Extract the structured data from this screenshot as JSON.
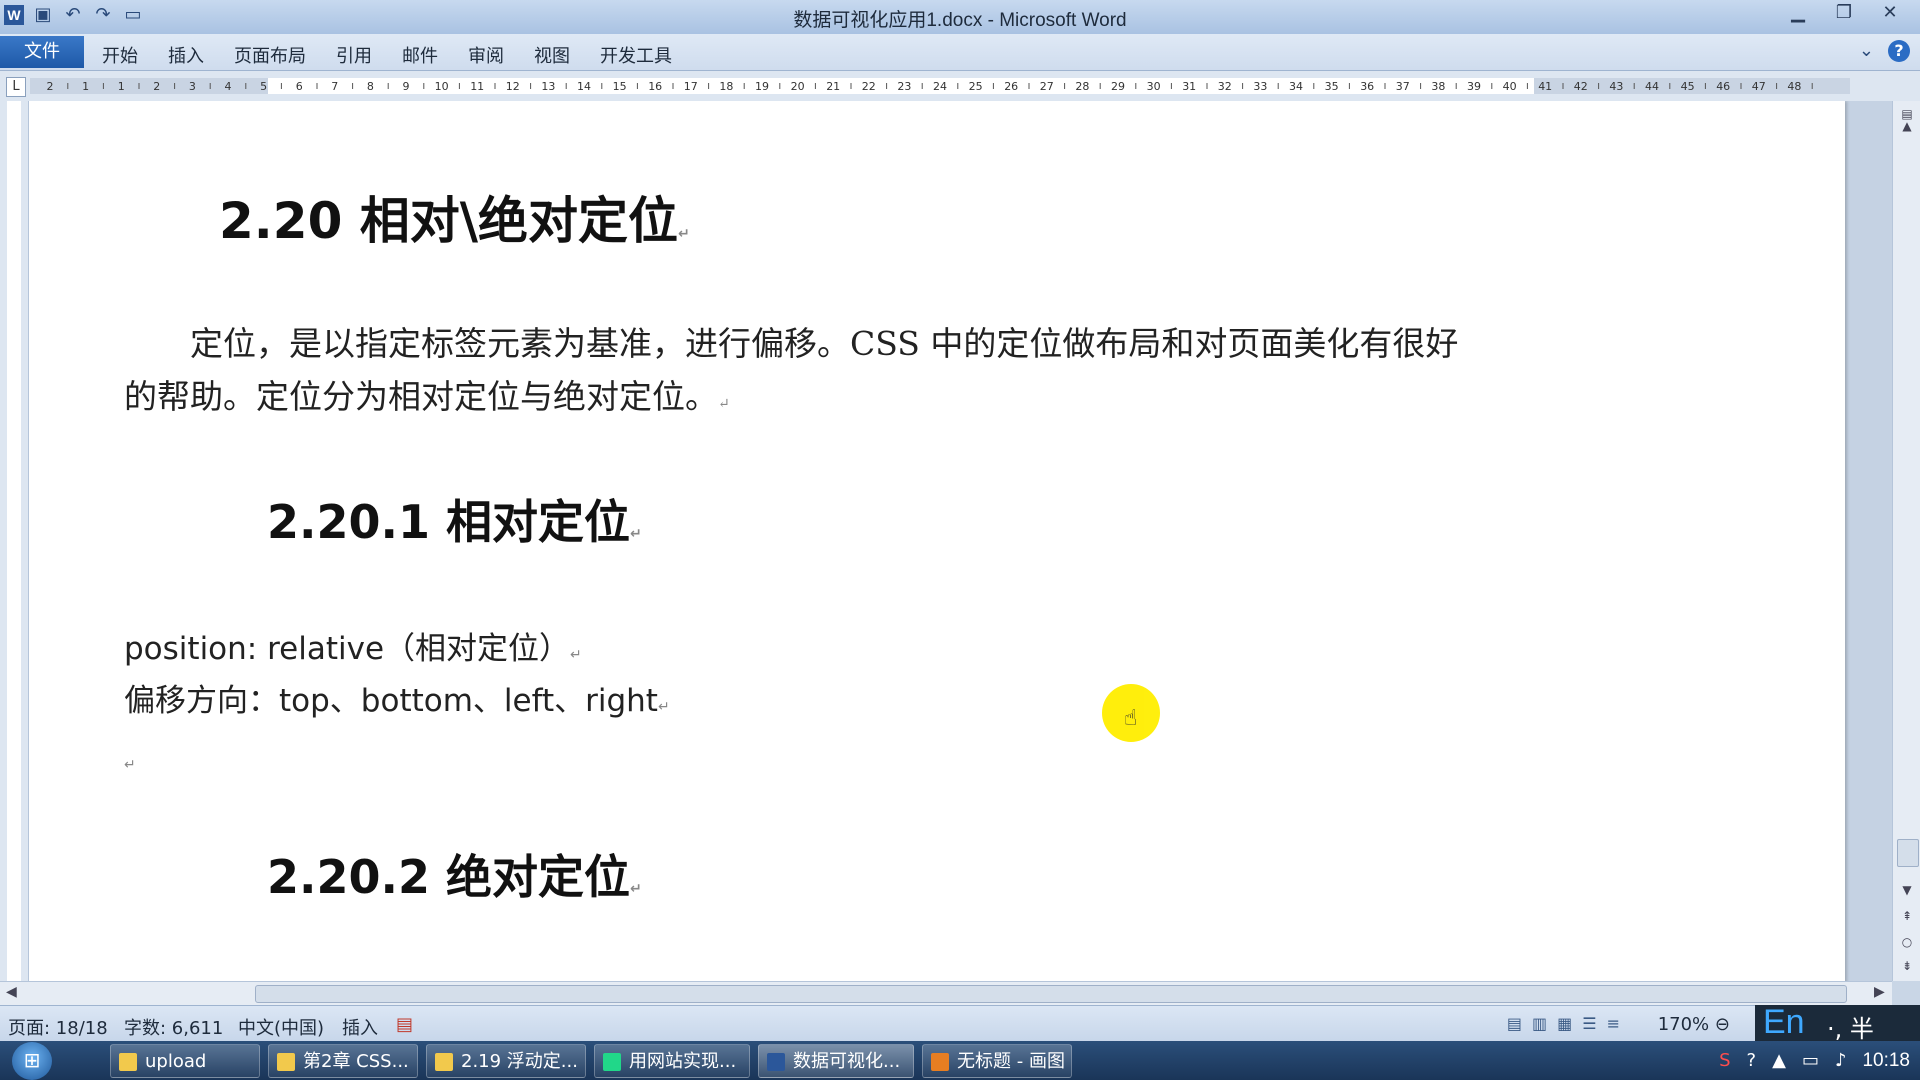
{
  "window": {
    "title": "数据可视化应用1.docx - Microsoft Word"
  },
  "qat": [
    "save-icon",
    "undo-icon",
    "redo-icon",
    "new-doc-icon"
  ],
  "ribbon": {
    "file_tab": "文件",
    "tabs": [
      "开始",
      "插入",
      "页面布局",
      "引用",
      "邮件",
      "审阅",
      "视图",
      "开发工具"
    ]
  },
  "ruler": {
    "corner": "L",
    "numbers": [
      "2",
      "1",
      "1",
      "2",
      "3",
      "4",
      "5",
      "6",
      "7",
      "8",
      "9",
      "10",
      "11",
      "12",
      "13",
      "14",
      "15",
      "16",
      "17",
      "18",
      "19",
      "20",
      "21",
      "22",
      "23",
      "24",
      "25",
      "26",
      "27",
      "28",
      "29",
      "30",
      "31",
      "32",
      "33",
      "34",
      "35",
      "36",
      "37",
      "38",
      "39",
      "40",
      "41",
      "42",
      "43",
      "44",
      "45",
      "46",
      "47",
      "48"
    ]
  },
  "document": {
    "h1": "2.20 相对\\绝对定位",
    "para_line1": "定位，是以指定标签元素为基准，进行偏移。CSS 中的定位做布局和对页面美化有很好",
    "para_line2": "的帮助。定位分为相对定位与绝对定位。",
    "h2_relative": "2.20.1 相对定位",
    "line_position": "position: relative（相对定位）",
    "line_offset": "偏移方向：top、bottom、left、right",
    "h2_absolute": "2.20.2 绝对定位",
    "para_mark": "↵"
  },
  "status": {
    "page": "页面: 18/18",
    "words": "字数: 6,611",
    "lang": "中文(中国)",
    "mode": "插入",
    "zoom": "170%"
  },
  "ime": {
    "en": "En",
    "rest": "·, 半"
  },
  "taskbar": {
    "items": [
      "upload",
      "第2章 CSS...",
      "2.19 浮动定...",
      "用网站实现...",
      "数据可视化...",
      "无标题 - 画图"
    ],
    "clock": "10:18"
  },
  "colors": {
    "accent": "#2b579a",
    "cursor_highlight": "#ffee00"
  }
}
